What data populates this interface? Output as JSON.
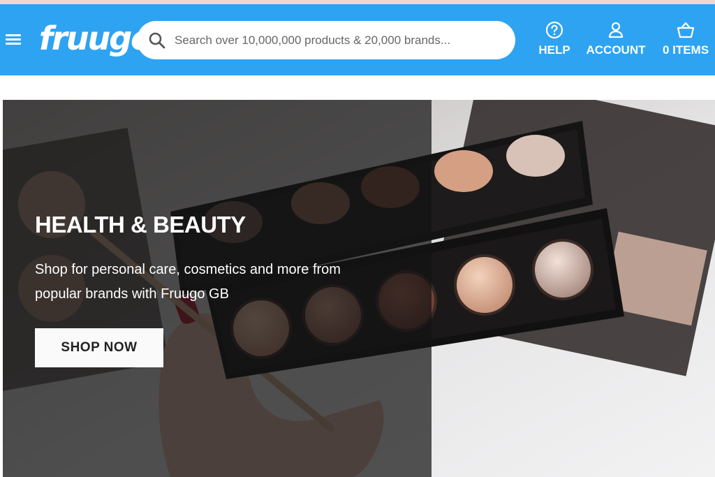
{
  "header": {
    "logo_text": "fruugo",
    "search": {
      "placeholder": "Search over 10,000,000 products & 20,000 brands..."
    },
    "nav": {
      "help_label": "HELP",
      "account_label": "ACCOUNT",
      "basket_label": "0 ITEMS"
    },
    "brand_color": "#2ea3f2"
  },
  "hero": {
    "title": "HEALTH & BEAUTY",
    "description": "Shop for personal care, cosmetics and more from popular brands with Fruugo GB",
    "cta_label": "SHOP NOW"
  },
  "icons": [
    "menu-icon",
    "search-icon",
    "help-circle-icon",
    "user-icon",
    "basket-icon"
  ]
}
